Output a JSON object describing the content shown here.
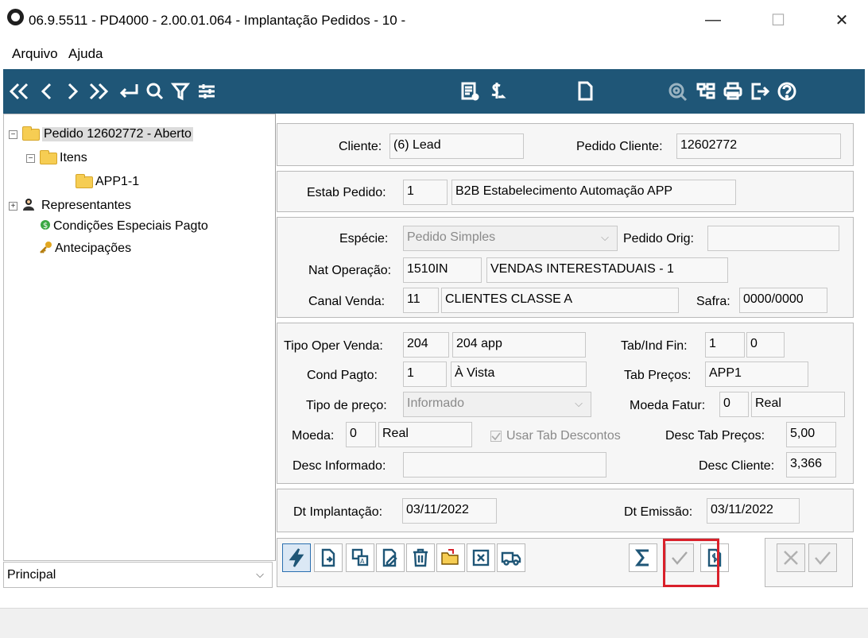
{
  "window": {
    "title": "06.9.5511 - PD4000 - 2.00.01.064 - Implantação Pedidos - 10 -",
    "minimize": "—",
    "maximize": "☐",
    "close": "✕"
  },
  "menu": {
    "items": [
      "Arquivo",
      "Ajuda"
    ]
  },
  "toolbar": {
    "accent": "#1f5677",
    "icons": [
      "first-icon",
      "prev-icon",
      "next-icon",
      "last-icon",
      "return-icon",
      "search-icon",
      "filter-icon",
      "settings-icon",
      "report-icon",
      "currency-icon",
      "document-icon",
      "view-icon",
      "tree-icon",
      "print-icon",
      "exit-icon",
      "help-icon"
    ]
  },
  "tree": {
    "root": "Pedido 12602772 - Aberto",
    "itens": "Itens",
    "item1": "APP1-1",
    "representantes": "Representantes",
    "condicoes": "Condições Especiais Pagto",
    "antecipacoes": "Antecipações",
    "select_value": "Principal"
  },
  "form": {
    "cliente_label": "Cliente:",
    "cliente_value": "(6) Lead",
    "pedido_cliente_label": "Pedido Cliente:",
    "pedido_cliente_value": "12602772",
    "estab_label": "Estab Pedido:",
    "estab_code": "1",
    "estab_desc": "B2B  Estabelecimento Automação APP",
    "especie_label": "Espécie:",
    "especie_value": "Pedido Simples",
    "pedido_orig_label": "Pedido Orig:",
    "pedido_orig_value": "",
    "nat_op_label": "Nat Operação:",
    "nat_op_code": "1510IN",
    "nat_op_desc": "VENDAS INTERESTADUAIS - 1",
    "canal_label": "Canal Venda:",
    "canal_code": "11",
    "canal_desc": "CLIENTES CLASSE A",
    "safra_label": "Safra:",
    "safra_value": "0000/0000",
    "tipo_oper_label": "Tipo Oper Venda:",
    "tipo_oper_code": "204",
    "tipo_oper_desc": "204 app",
    "tab_ind_label": "Tab/Ind Fin:",
    "tab_ind_1": "1",
    "tab_ind_2": "0",
    "cond_pagto_label": "Cond Pagto:",
    "cond_pagto_code": "1",
    "cond_pagto_desc": "À Vista",
    "tab_precos_label": "Tab Preços:",
    "tab_precos_value": "APP1",
    "tipo_preco_label": "Tipo de preço:",
    "tipo_preco_value": "Informado",
    "moeda_fatur_label": "Moeda Fatur:",
    "moeda_fatur_code": "0",
    "moeda_fatur_desc": "Real",
    "moeda_label": "Moeda:",
    "moeda_code": "0",
    "moeda_desc": "Real",
    "usar_tab_label": "Usar Tab Descontos",
    "desc_tab_label": "Desc Tab Preços:",
    "desc_tab_value": "5,00",
    "desc_informado_label": "Desc Informado:",
    "desc_informado_value": "",
    "desc_cliente_label": "Desc Cliente:",
    "desc_cliente_value": "3,366",
    "dt_impl_label": "Dt Implantação:",
    "dt_impl_value": "03/11/2022",
    "dt_emissao_label": "Dt Emissão:",
    "dt_emissao_value": "03/11/2022"
  },
  "actions": {
    "highlight_color": "#d9202a",
    "icons": [
      "lightning-icon",
      "new-doc-icon",
      "translate-icon",
      "edit-doc-icon",
      "delete-icon",
      "open-folder-icon",
      "cancel-box-icon",
      "truck-icon",
      "sum-icon",
      "check-icon",
      "copy-doc-icon",
      "cancel-icon",
      "confirm-icon"
    ]
  }
}
